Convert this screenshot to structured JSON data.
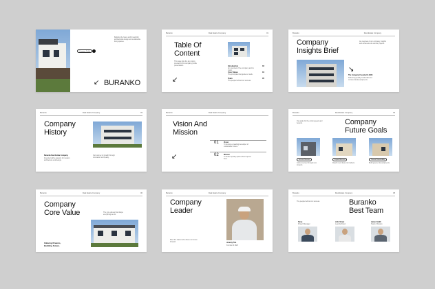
{
  "brand": "Buranko",
  "slides": {
    "s1": {
      "title": "BURANKO",
      "pill": "Company Profile",
      "blurb": "Building the future with thoughtful architectural design and sustainable living spaces."
    },
    "s2": {
      "header_left": "Buranko",
      "header_center": "Real Estate Company",
      "header_right": "01",
      "title_l1": "Table Of",
      "title_l2": "Content",
      "blurb": "This page lists the key topics covered in this company profile presentation.",
      "items": [
        {
          "label": "Introduction",
          "num": "03",
          "desc": "An overview of the company and its vision."
        },
        {
          "label": "Core Values",
          "num": "04",
          "desc": "The principles that guide our work."
        },
        {
          "label": "Team",
          "num": "05",
          "desc": "The people behind our success."
        }
      ]
    },
    "s3": {
      "header_left": "Buranko",
      "header_center": "Real Estate Company",
      "title_l1": "Company",
      "title_l2": "Insights Brief",
      "blurb": "An overview of our company insights and achievements across projects.",
      "sub_bold": "The Company Founded In 2024",
      "sub_text": "Delivering quality residential and commercial developments."
    },
    "s4": {
      "header_left": "Buranko",
      "header_center": "Real Estate Company",
      "header_right": "03",
      "title_l1": "Company",
      "title_l2": "History",
      "bold": "Buranko Real Estate Company",
      "text_a": "Founded with a passion for modern architecture and design.",
      "text_b": "Our journey of growth through innovation and quality."
    },
    "s5": {
      "header_left": "Buranko",
      "header_center": "Real Estate Company",
      "title_l1": "Vision And",
      "title_l2": "Mission",
      "items": [
        {
          "num": "01",
          "label": "Vision",
          "desc": "To become a leading developer of sustainable homes."
        },
        {
          "num": "02",
          "label": "Mission",
          "desc": "To deliver quality spaces that improve lives."
        }
      ]
    },
    "s6": {
      "header_left": "Buranko",
      "header_center": "Real Estate Company",
      "header_right": "05",
      "title_l1": "Company",
      "title_l2": "Future Goals",
      "blurb": "Our goals for the coming years and beyond.",
      "goals": [
        {
          "label": "Increase Revenue",
          "desc": "Grow revenue through new projects."
        },
        {
          "label": "Expand Business",
          "desc": "Reach new cities and markets."
        },
        {
          "label": "Promote Sustainability",
          "desc": "Build greener developments."
        }
      ]
    },
    "s7": {
      "header_left": "Buranko",
      "header_center": "Real Estate Company",
      "header_right": "06",
      "title_l1": "Company",
      "title_l2": "Core Value",
      "blurb": "The core values that shape everything we do.",
      "bold_l1": "Imbuing Dreams,",
      "bold_l2": "Building Future."
    },
    "s8": {
      "header_left": "Buranko",
      "header_center": "Real Estate Company",
      "title_l1": "Company",
      "title_l2": "Leader",
      "blurb": "Meet the leader who drives our vision forward.",
      "name": "Jeremy Tan",
      "role": "Founder & CEO"
    },
    "s9": {
      "header_left": "Buranko",
      "header_center": "Real Estate Company",
      "header_right": "08",
      "title_l1": "Buranko",
      "title_l2": "Best Team",
      "blurb": "The people behind our success.",
      "team": [
        {
          "name": "Steve",
          "desc": "Project Manager"
        },
        {
          "name": "John Street",
          "desc": "Lead Architect"
        },
        {
          "name": "James Smith",
          "desc": "Head of Design"
        }
      ]
    }
  }
}
